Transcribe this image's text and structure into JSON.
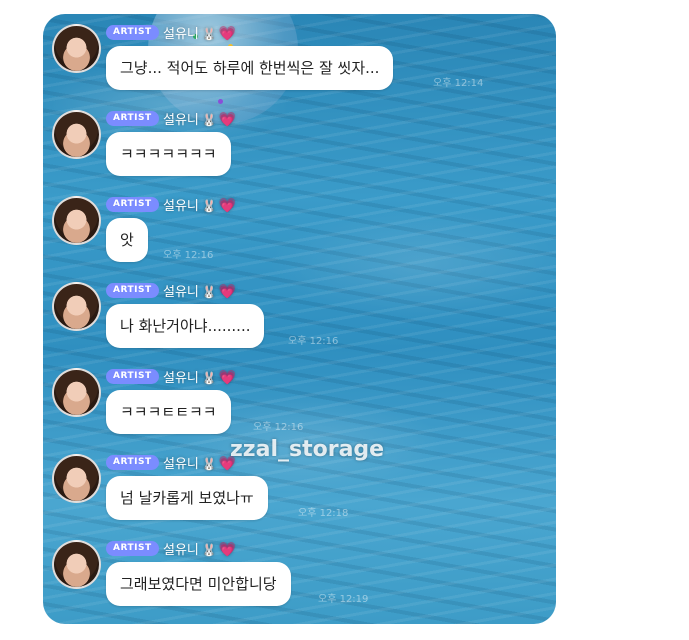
{
  "chat": {
    "badge_label": "ARTIST",
    "sender_name": "설유니",
    "sender_emoji": "🐰",
    "heart_emoji": "💗",
    "messages": [
      {
        "text": "그냥... 적어도 하루에 한번씩은 잘 씻자...",
        "time": "오후 12:14"
      },
      {
        "text": "ㅋㅋㅋㅋㅋㅋㅋ",
        "time": ""
      },
      {
        "text": "앗",
        "time": "오후 12:16"
      },
      {
        "text": "나 화난거아냐.........",
        "time": "오후 12:16"
      },
      {
        "text": "ㅋㅋㅋㅌㅌㅋㅋ",
        "time": "오후 12:16"
      },
      {
        "text": "넘 날카롭게 보였나ㅠ",
        "time": "오후 12:18"
      },
      {
        "text": "그래보였다면 미안합니당",
        "time": "오후 12:19"
      }
    ]
  },
  "watermark": "zzal_storage",
  "colors": {
    "badge": "#7b8cff",
    "water": "#2f8fc0",
    "heart": "#ff4fa3"
  }
}
